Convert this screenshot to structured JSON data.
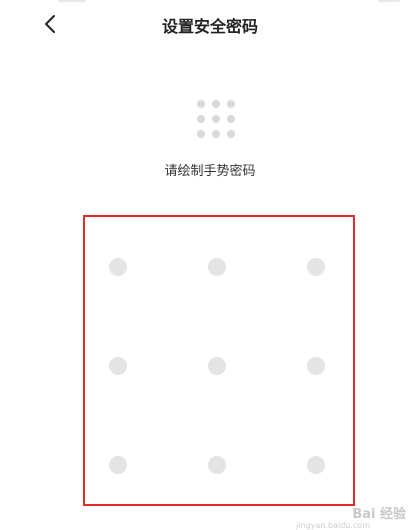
{
  "header": {
    "title": "设置安全密码",
    "back_icon": "chevron-left-icon"
  },
  "preview": {
    "icon": "pattern-preview-icon",
    "dot_color": "#d9d9d9"
  },
  "instruction": "请绘制手势密码",
  "pattern": {
    "rows": 3,
    "cols": 3,
    "dot_color": "#e4e4e4",
    "highlight_border_color": "#e02b2b"
  },
  "watermark": {
    "text": "Bai 经验",
    "subtext": "jingyan.baidu.com"
  }
}
